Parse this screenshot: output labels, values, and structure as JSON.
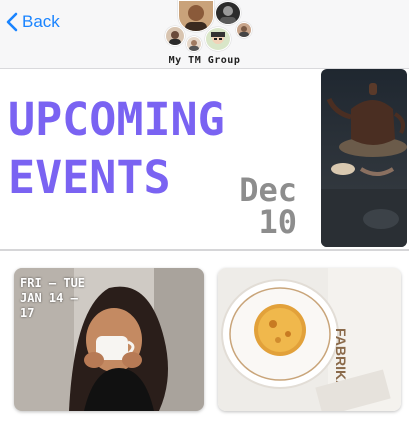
{
  "nav": {
    "back_label": "Back",
    "group_name": "My TM Group"
  },
  "hero": {
    "title_line1": "UPCOMING",
    "title_line2": "EVENTS",
    "month": "Dec",
    "day": "10",
    "image": "teapot-photo"
  },
  "cards": [
    {
      "date_line1": "FRI – TUE",
      "date_line2": "JAN 14 –",
      "date_line3": "17",
      "image": "woman-drinking-coffee-photo"
    },
    {
      "date_line1": "",
      "image": "pastry-on-plate-photo"
    }
  ],
  "colors": {
    "accent": "#7a63f2",
    "link": "#1a84ff",
    "date_gray": "#8d8d8d"
  }
}
